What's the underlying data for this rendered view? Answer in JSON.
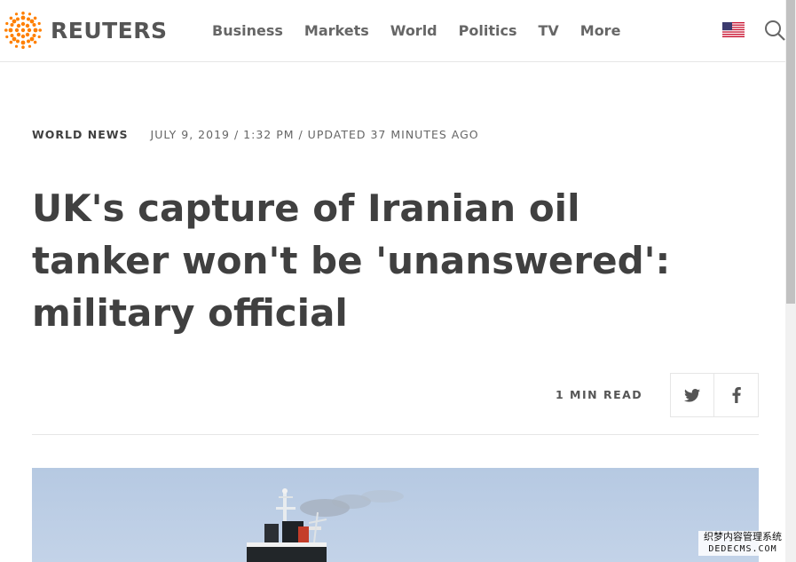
{
  "header": {
    "brand": "REUTERS",
    "nav": [
      "Business",
      "Markets",
      "World",
      "Politics",
      "TV",
      "More"
    ],
    "flag_icon": "us-flag-icon",
    "search_icon": "search-icon",
    "accent_color": "#ff8000"
  },
  "article": {
    "section": "WORLD NEWS",
    "dateline": "JULY 9, 2019 / 1:32 PM / UPDATED 37 MINUTES AGO",
    "headline": "UK's capture of Iranian oil tanker won't be 'unanswered': military official",
    "read_time": "1 MIN READ",
    "share": [
      "twitter-icon",
      "facebook-icon"
    ]
  },
  "watermark": {
    "line1": "织梦内容管理系统",
    "line2": "DEDECMS.COM"
  }
}
